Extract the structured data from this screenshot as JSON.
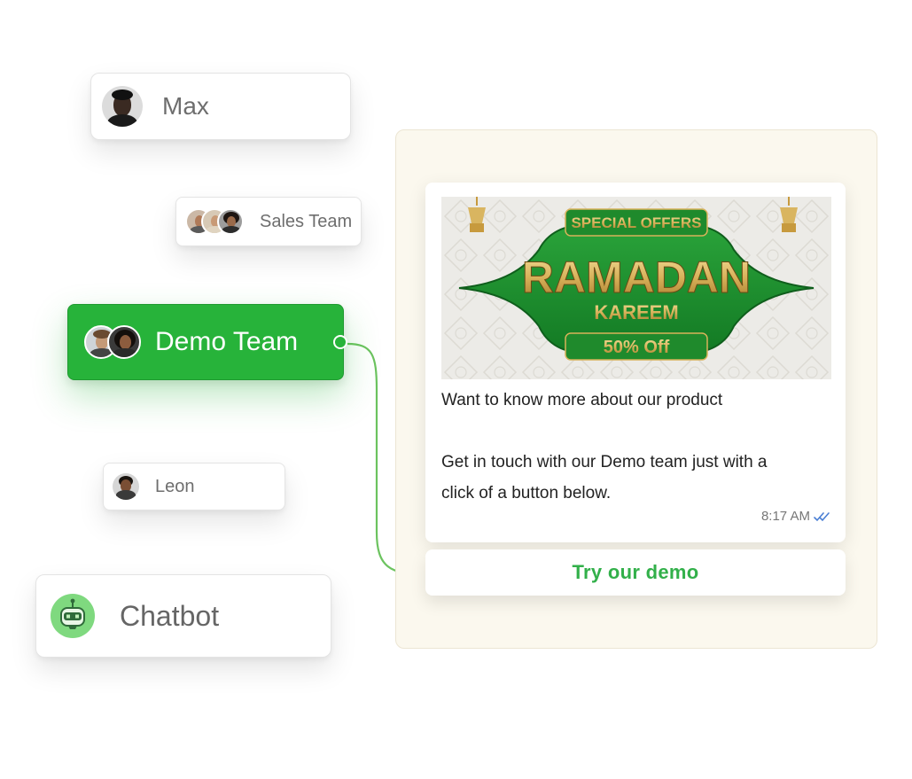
{
  "chips": {
    "max": {
      "label": "Max"
    },
    "sales_team": {
      "label": "Sales Team"
    },
    "demo_team": {
      "label": "Demo Team"
    },
    "leon": {
      "label": "Leon"
    },
    "chatbot": {
      "label": "Chatbot"
    }
  },
  "message": {
    "banner": {
      "special_offers": "SPECIAL OFFERS",
      "headline": "RAMADAN",
      "subheadline": "KAREEM",
      "discount": "50% Off"
    },
    "line_1": "Want to know more about our product",
    "line_2": "Get in touch with our Demo team just with a",
    "line_3": "click of a button below.",
    "time": "8:17 AM",
    "status_icon": "double-check-icon"
  },
  "cta": {
    "label": "Try our demo"
  },
  "colors": {
    "accent_green": "#27b33a",
    "cta_text": "#32b04a",
    "panel_bg": "#fbf8ee",
    "banner_green": "#1f8a2c",
    "banner_gold": "#d8b25a",
    "read_check": "#4a7fd4"
  }
}
